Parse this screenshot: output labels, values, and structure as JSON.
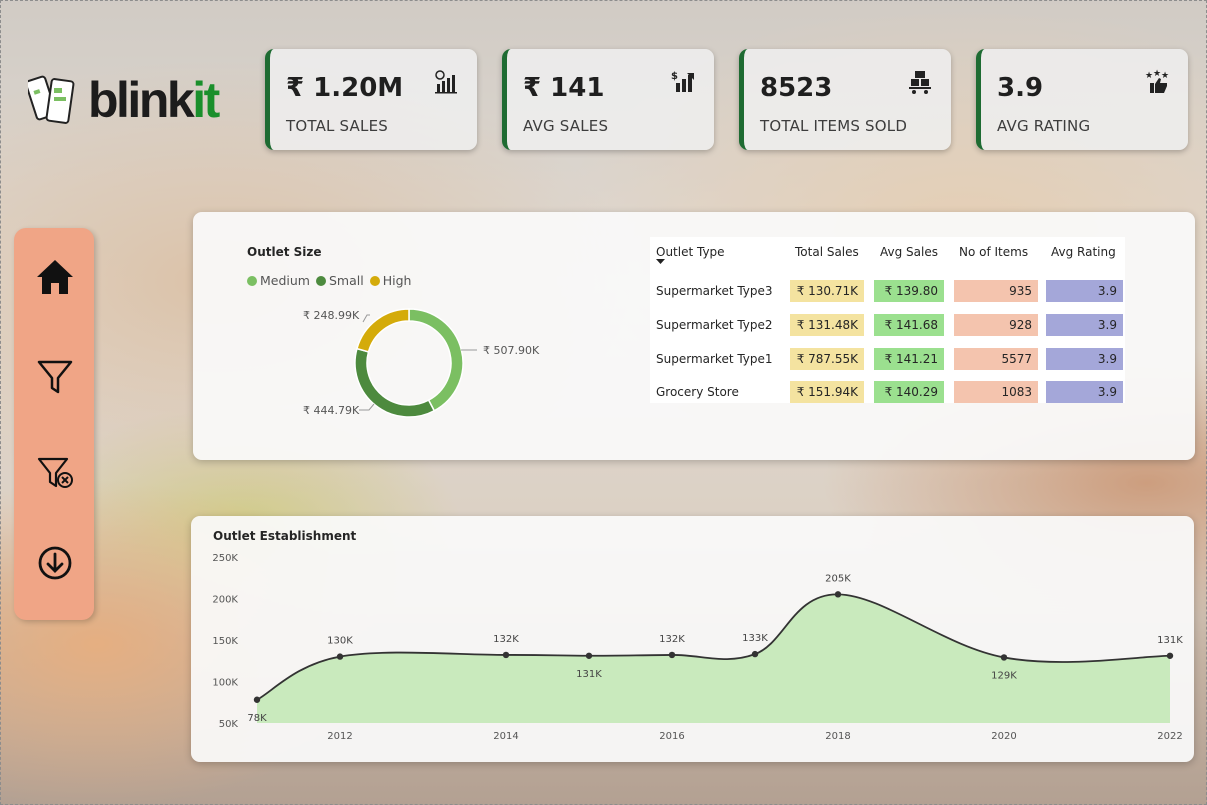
{
  "logo": {
    "text_dark": "blink",
    "text_green": "it",
    "icon": "phones-icon"
  },
  "kpis": [
    {
      "value": "₹ 1.20M",
      "label": "TOTAL SALES",
      "icon": "sales-chart-icon"
    },
    {
      "value": "₹ 141",
      "label": "AVG SALES",
      "icon": "dollar-bars-icon"
    },
    {
      "value": "8523",
      "label": "TOTAL ITEMS SOLD",
      "icon": "items-cart-icon"
    },
    {
      "value": "3.9",
      "label": "AVG RATING",
      "icon": "stars-thumb-icon"
    }
  ],
  "sidebar": {
    "items": [
      "home-icon",
      "filter-icon",
      "clear-filter-icon",
      "download-icon"
    ]
  },
  "outlet_size": {
    "title": "Outlet Size",
    "legend": [
      "Medium",
      "Small",
      "High"
    ],
    "slices": [
      {
        "name": "Medium",
        "label": "₹ 507.90K",
        "value": 507.9,
        "color": "#7bbf62"
      },
      {
        "name": "Small",
        "label": "₹ 444.79K",
        "value": 444.79,
        "color": "#4d8a3e"
      },
      {
        "name": "High",
        "label": "₹ 248.99K",
        "value": 248.99,
        "color": "#d4ab0a"
      }
    ]
  },
  "outlet_table": {
    "headers": [
      "Outlet Type",
      "Total Sales",
      "Avg Sales",
      "No of Items",
      "Avg Rating"
    ],
    "rows": [
      {
        "type": "Supermarket Type3",
        "total": "₹ 130.71K",
        "avg": "₹ 139.80",
        "items": "935",
        "rating": "3.9"
      },
      {
        "type": "Supermarket Type2",
        "total": "₹ 131.48K",
        "avg": "₹ 141.68",
        "items": "928",
        "rating": "3.9"
      },
      {
        "type": "Supermarket Type1",
        "total": "₹ 787.55K",
        "avg": "₹ 141.21",
        "items": "5577",
        "rating": "3.9"
      },
      {
        "type": "Grocery Store",
        "total": "₹ 151.94K",
        "avg": "₹ 140.29",
        "items": "1083",
        "rating": "3.9"
      }
    ],
    "colors": {
      "total": "#f4e3a0",
      "avg": "#9be08f",
      "items": "#f4c4ae",
      "rating": "#a4a7d9"
    }
  },
  "chart_data": [
    {
      "type": "pie",
      "title": "Outlet Size",
      "categories": [
        "Medium",
        "Small",
        "High"
      ],
      "values": [
        507.9,
        444.79,
        248.99
      ]
    },
    {
      "type": "area",
      "title": "Outlet Establishment",
      "x": [
        2011,
        2012,
        2014,
        2015,
        2016,
        2017,
        2018,
        2020,
        2022
      ],
      "values": [
        78,
        130,
        132,
        131,
        132,
        133,
        205,
        129,
        131
      ],
      "point_labels": [
        "78K",
        "130K",
        "132K",
        "131K",
        "132K",
        "133K",
        "205K",
        "129K",
        "131K"
      ],
      "x_ticks": [
        "2012",
        "2014",
        "2016",
        "2018",
        "2020",
        "2022"
      ],
      "y_ticks": [
        "50K",
        "100K",
        "150K",
        "200K",
        "250K"
      ],
      "ylim": [
        50,
        250
      ],
      "fill": "#c9eabd",
      "line": "#333333"
    }
  ]
}
